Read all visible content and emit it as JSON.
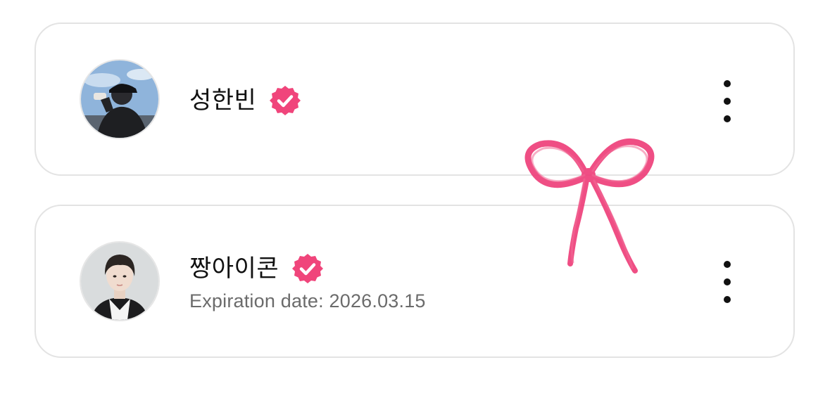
{
  "accent_color": "#f0457b",
  "cards": [
    {
      "name": "성한빈",
      "verified": true,
      "avatar": "avatar-photo-man-black-cap",
      "menu_icon": "more-vertical-icon"
    },
    {
      "name": "짱아이콘",
      "verified": true,
      "subtitle": "Expiration date: 2026.03.15",
      "avatar": "avatar-photo-man-white-collar",
      "menu_icon": "more-vertical-icon"
    }
  ],
  "decoration": "pink-ribbon-bow-sticker"
}
